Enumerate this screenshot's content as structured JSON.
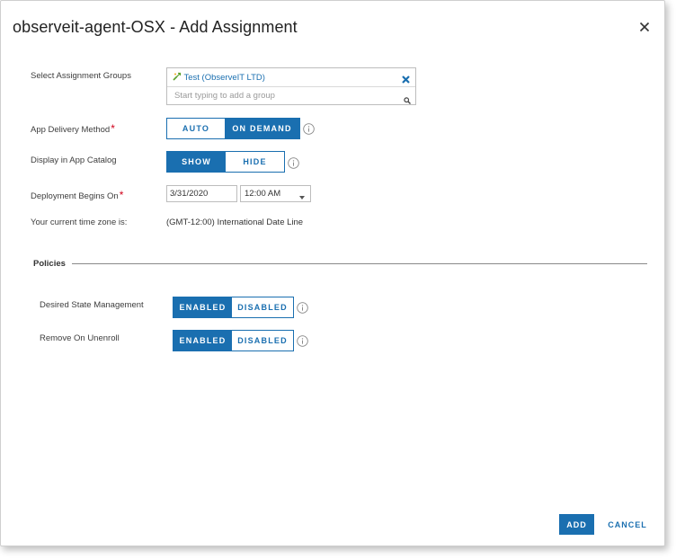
{
  "dialog": {
    "title": "observeit-agent-OSX - Add Assignment"
  },
  "form": {
    "assignment_groups": {
      "label": "Select Assignment Groups",
      "selected_group": "Test (ObserveIT LTD)",
      "placeholder": "Start typing to add a group",
      "value": ""
    },
    "delivery_method": {
      "label": "App Delivery Method",
      "required_mark": "*",
      "options": [
        "AUTO",
        "ON DEMAND"
      ],
      "selected": "ON DEMAND"
    },
    "display_in_catalog": {
      "label": "Display in App Catalog",
      "options": [
        "SHOW",
        "HIDE"
      ],
      "selected": "SHOW"
    },
    "deployment_begins": {
      "label": "Deployment Begins On",
      "required_mark": "*",
      "date": "3/31/2020",
      "time": "12:00 AM"
    },
    "timezone": {
      "label": "Your current time zone is:",
      "value": "(GMT-12:00) International Date Line"
    }
  },
  "policies": {
    "section_title": "Policies",
    "desired_state": {
      "label": "Desired State Management",
      "options": [
        "ENABLED",
        "DISABLED"
      ],
      "selected": "ENABLED"
    },
    "remove_on_unenroll": {
      "label": "Remove On Unenroll",
      "options": [
        "ENABLED",
        "DISABLED"
      ],
      "selected": "ENABLED"
    }
  },
  "footer": {
    "add_label": "ADD",
    "cancel_label": "CANCEL"
  },
  "colors": {
    "accent": "#1a6fb0",
    "required": "#d0021b",
    "group_icon": "#5aa02c"
  },
  "icons": {
    "close": "close-icon",
    "group": "smart-group-icon",
    "remove_group": "remove-x-icon",
    "search": "search-icon",
    "info": "info-icon",
    "dropdown": "chevron-down-icon"
  }
}
